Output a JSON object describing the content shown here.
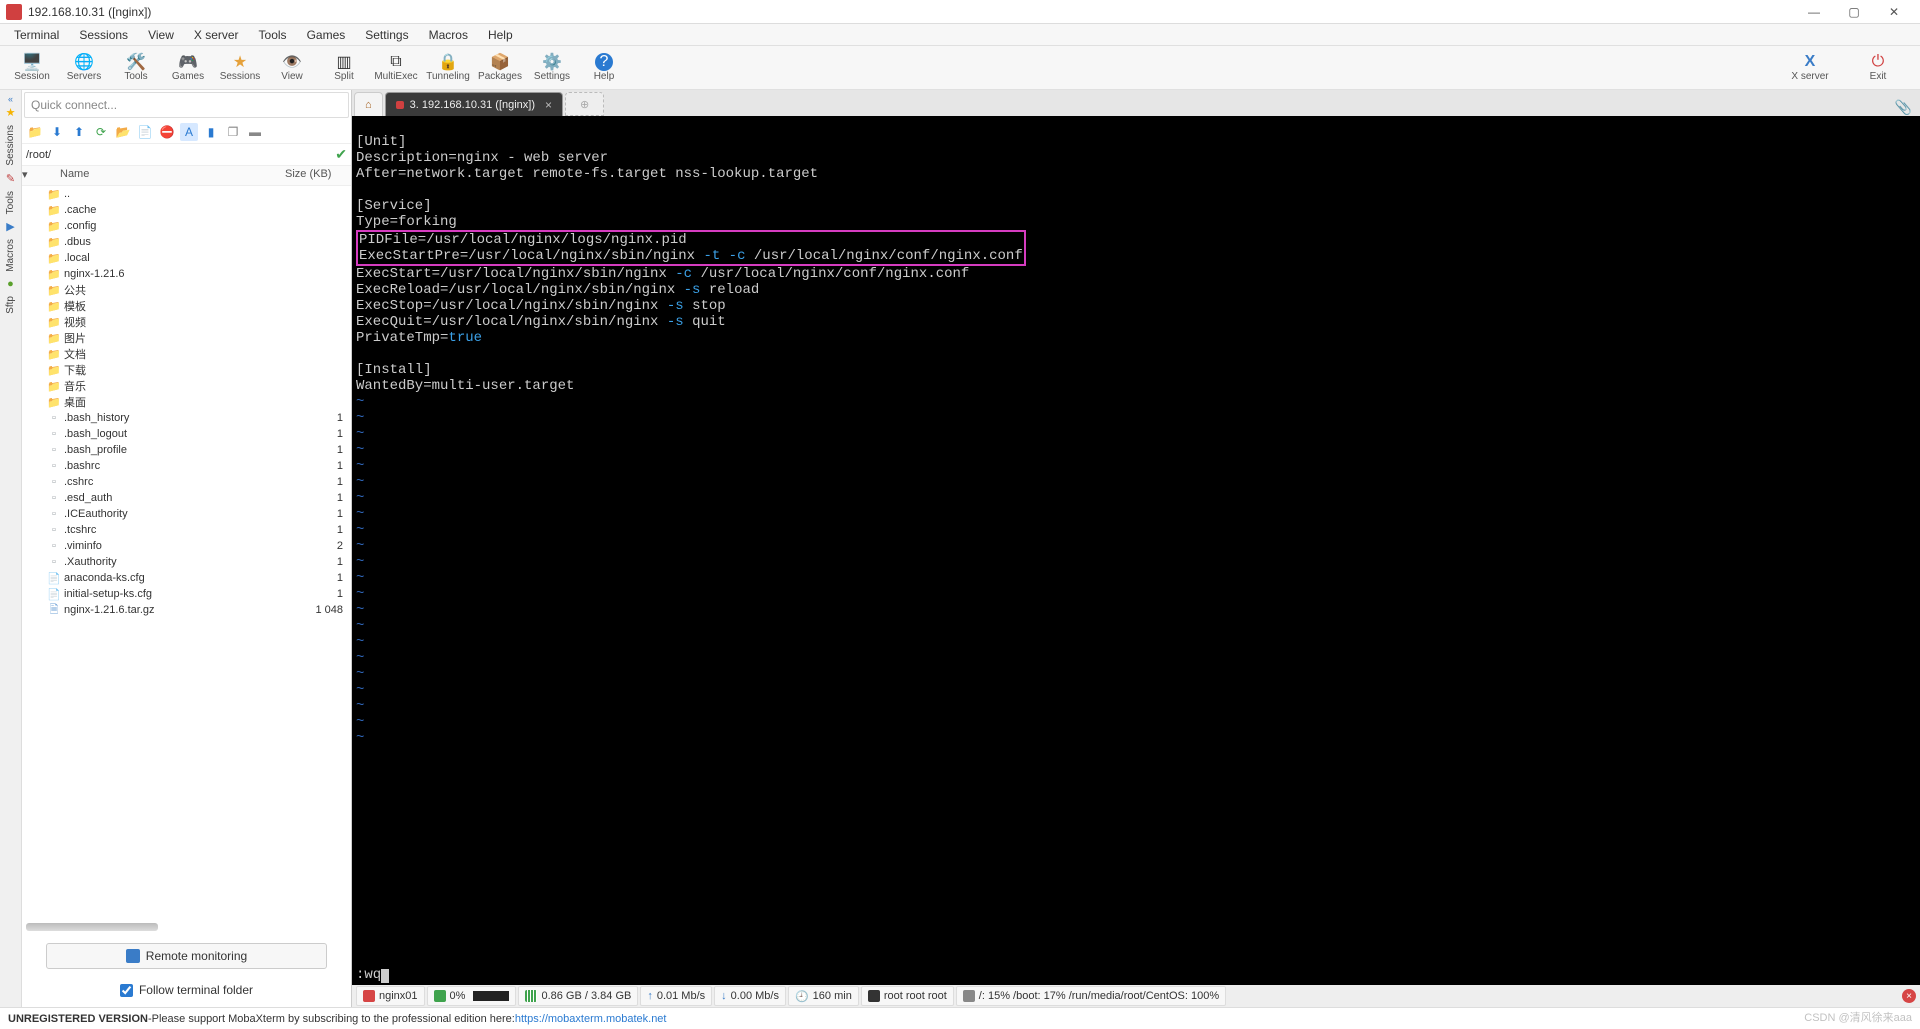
{
  "window": {
    "title": "192.168.10.31 ([nginx])"
  },
  "menubar": [
    "Terminal",
    "Sessions",
    "View",
    "X server",
    "Tools",
    "Games",
    "Settings",
    "Macros",
    "Help"
  ],
  "toolbar": {
    "items": [
      {
        "icon": "🖥️",
        "label": "Session"
      },
      {
        "icon": "🌐",
        "label": "Servers"
      },
      {
        "icon": "🛠️",
        "label": "Tools"
      },
      {
        "icon": "🎮",
        "label": "Games"
      },
      {
        "icon": "★",
        "label": "Sessions"
      },
      {
        "icon": "👁️",
        "label": "View"
      },
      {
        "icon": "▥",
        "label": "Split"
      },
      {
        "icon": "⧉",
        "label": "MultiExec"
      },
      {
        "icon": "🔒",
        "label": "Tunneling"
      },
      {
        "icon": "📦",
        "label": "Packages"
      },
      {
        "icon": "⚙️",
        "label": "Settings"
      },
      {
        "icon": "?",
        "label": "Help"
      }
    ],
    "xserver_label": "X server",
    "exit_label": "Exit"
  },
  "sidebar": {
    "quick_connect_placeholder": "Quick connect...",
    "vtabs": [
      "Sessions",
      "Tools",
      "Macros",
      "Sftp"
    ],
    "path": "/root/",
    "header": {
      "name": "Name",
      "size": "Size (KB)"
    },
    "files": [
      {
        "icon": "up",
        "name": "..",
        "size": ""
      },
      {
        "icon": "folder-g",
        "name": ".cache",
        "size": ""
      },
      {
        "icon": "folder-g",
        "name": ".config",
        "size": ""
      },
      {
        "icon": "folder-g",
        "name": ".dbus",
        "size": ""
      },
      {
        "icon": "folder-g",
        "name": ".local",
        "size": ""
      },
      {
        "icon": "folder",
        "name": "nginx-1.21.6",
        "size": ""
      },
      {
        "icon": "folder",
        "name": "公共",
        "size": ""
      },
      {
        "icon": "folder",
        "name": "模板",
        "size": ""
      },
      {
        "icon": "folder",
        "name": "视频",
        "size": ""
      },
      {
        "icon": "folder",
        "name": "图片",
        "size": ""
      },
      {
        "icon": "folder",
        "name": "文档",
        "size": ""
      },
      {
        "icon": "folder",
        "name": "下载",
        "size": ""
      },
      {
        "icon": "folder",
        "name": "音乐",
        "size": ""
      },
      {
        "icon": "folder",
        "name": "桌面",
        "size": ""
      },
      {
        "icon": "file-g",
        "name": ".bash_history",
        "size": "1"
      },
      {
        "icon": "file-g",
        "name": ".bash_logout",
        "size": "1"
      },
      {
        "icon": "file-g",
        "name": ".bash_profile",
        "size": "1"
      },
      {
        "icon": "file-g",
        "name": ".bashrc",
        "size": "1"
      },
      {
        "icon": "file-g",
        "name": ".cshrc",
        "size": "1"
      },
      {
        "icon": "file-g",
        "name": ".esd_auth",
        "size": "1"
      },
      {
        "icon": "file-g",
        "name": ".ICEauthority",
        "size": "1"
      },
      {
        "icon": "file-g",
        "name": ".tcshrc",
        "size": "1"
      },
      {
        "icon": "file-g",
        "name": ".viminfo",
        "size": "2"
      },
      {
        "icon": "file-g",
        "name": ".Xauthority",
        "size": "1"
      },
      {
        "icon": "text",
        "name": "anaconda-ks.cfg",
        "size": "1"
      },
      {
        "icon": "text",
        "name": "initial-setup-ks.cfg",
        "size": "1"
      },
      {
        "icon": "arch",
        "name": "nginx-1.21.6.tar.gz",
        "size": "1 048"
      }
    ],
    "remote_monitoring": "Remote monitoring",
    "follow": "Follow terminal folder"
  },
  "tabs": {
    "active_label": "3. 192.168.10.31 ([nginx])"
  },
  "editor": {
    "lines_pre": [
      "[Unit]",
      "Description=nginx - web server",
      "After=network.target remote-fs.target nss-lookup.target",
      "",
      "[Service]",
      "Type=forking"
    ],
    "hl1": "PIDFile=/usr/local/nginx/logs/nginx.pid",
    "hl2_a": "ExecStartPre=/usr/local/nginx/sbin/nginx ",
    "hl2_flags": "-t -c",
    "hl2_b": " /usr/local/nginx/conf/nginx.conf",
    "l_execstart_a": "ExecStart=/usr/local/nginx/sbin/nginx ",
    "l_execstart_flag": "-c",
    "l_execstart_b": " /usr/local/nginx/conf/nginx.conf",
    "l_reload_a": "ExecReload=/usr/local/nginx/sbin/nginx ",
    "l_reload_flag": "-s",
    "l_reload_b": " reload",
    "l_stop_a": "ExecStop=/usr/local/nginx/sbin/nginx ",
    "l_stop_flag": "-s",
    "l_stop_b": " stop",
    "l_quit_a": "ExecQuit=/usr/local/nginx/sbin/nginx ",
    "l_quit_flag": "-s",
    "l_quit_b": " quit",
    "l_priv_a": "PrivateTmp=",
    "l_priv_b": "true",
    "lines_post": [
      "",
      "[Install]",
      "WantedBy=multi-user.target"
    ],
    "tilde": "~",
    "empty": "",
    "cmd": ":wq"
  },
  "term_footer": {
    "host": "nginx01",
    "cpu": "0%",
    "mem": "0.86 GB / 3.84 GB",
    "up": "0.01 Mb/s",
    "dn": "0.00 Mb/s",
    "uptime": "160 min",
    "user": "root  root  root",
    "disks": "/: 15%   /boot: 17%   /run/media/root/CentOS: 100%"
  },
  "statusbar": {
    "unreg": "UNREGISTERED VERSION",
    "sep": " - ",
    "msg": "Please support MobaXterm by subscribing to the professional edition here:   ",
    "link": "https://mobaxterm.mobatek.net",
    "watermark": "CSDN @清风徐来aaa"
  }
}
